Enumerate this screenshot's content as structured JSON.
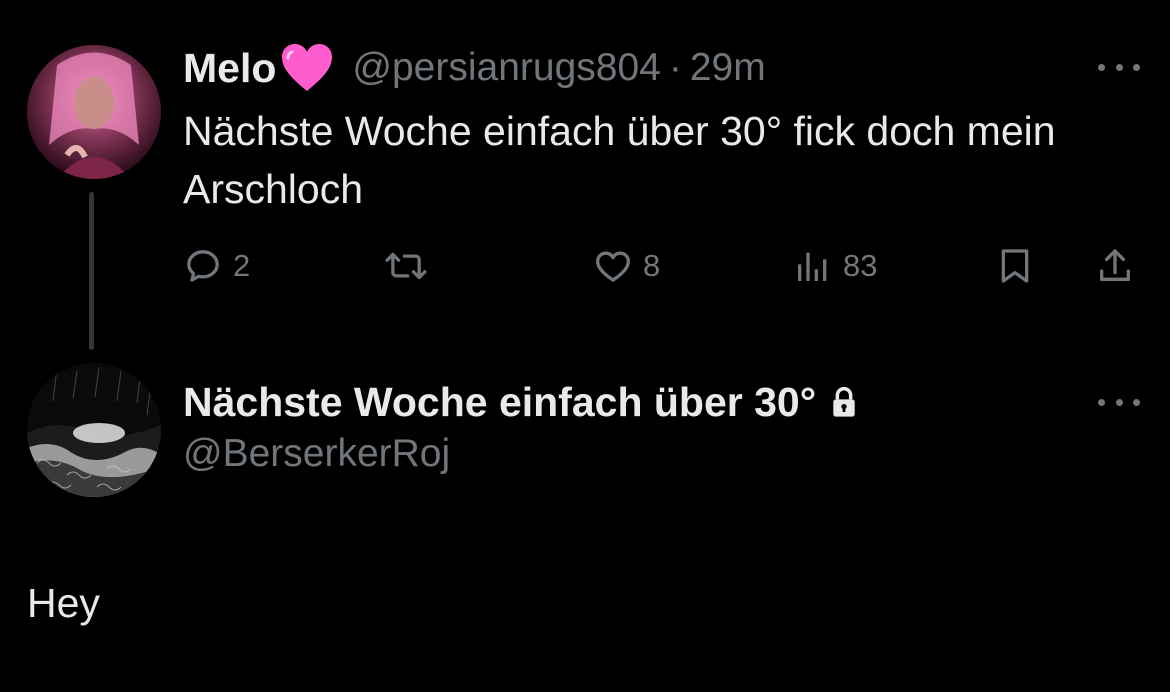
{
  "tweet": {
    "author": {
      "display_name": "Melo",
      "name_emoji": "pink-heart-emoji",
      "handle": "@persianrugs804",
      "separator": "·",
      "time": "29m",
      "avatar": "avatar-pink-portrait"
    },
    "text": "Nächste Woche einfach über 30° fick doch mein Arschloch",
    "actions": {
      "reply_count": "2",
      "retweet_count": "",
      "like_count": "8",
      "views_count": "83"
    },
    "icons": [
      "reply-icon",
      "retweet-icon",
      "like-icon",
      "views-icon",
      "bookmark-icon",
      "share-icon",
      "more-icon"
    ]
  },
  "reply": {
    "author": {
      "display_name": "Nächste Woche einfach über 30°",
      "handle": "@BerserkerRoj",
      "protected_icon": "lock-icon",
      "avatar": "avatar-dark-landscape"
    },
    "text": "Hey"
  },
  "colors": {
    "background": "#000000",
    "primary_text": "#e7e9ea",
    "secondary_text": "#71767b",
    "thread_line": "#333639",
    "heart": "#ff5ccf"
  }
}
